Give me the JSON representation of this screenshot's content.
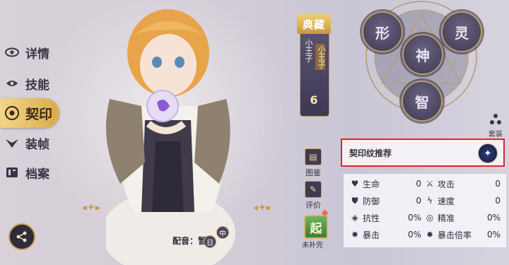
{
  "nav": {
    "items": [
      {
        "label": "详情",
        "icon": "eye-icon"
      },
      {
        "label": "技能",
        "icon": "skill-icon"
      },
      {
        "label": "契印",
        "icon": "seal-icon",
        "active": true
      },
      {
        "label": "装帧",
        "icon": "frame-icon"
      },
      {
        "label": "档案",
        "icon": "archive-icon"
      }
    ]
  },
  "plate": {
    "badge": "典藏",
    "title": "小王子",
    "name": "小王子",
    "level": "6"
  },
  "runes": [
    "形",
    "灵",
    "神",
    "智"
  ],
  "suit": {
    "label": "套装"
  },
  "side": {
    "codex": "图鉴",
    "review": "评价",
    "qi": "起",
    "qi_label": "未补完"
  },
  "recommend": {
    "label": "契印纹推荐"
  },
  "stats": {
    "left": [
      {
        "label": "生命",
        "value": "0",
        "icon": "heart-icon"
      },
      {
        "label": "防御",
        "value": "0",
        "icon": "shield-icon"
      },
      {
        "label": "抗性",
        "value": "0%",
        "icon": "resist-icon"
      },
      {
        "label": "暴击",
        "value": "0%",
        "icon": "crit-icon"
      }
    ],
    "right": [
      {
        "label": "攻击",
        "value": "0",
        "icon": "sword-icon"
      },
      {
        "label": "速度",
        "value": "0",
        "icon": "speed-icon"
      },
      {
        "label": "精准",
        "value": "0%",
        "icon": "target-icon"
      },
      {
        "label": "暴击倍率",
        "value": "0%",
        "icon": "crit-rate-icon"
      }
    ]
  },
  "voice": {
    "label": "配音：暂无",
    "lang1": "日",
    "lang2": "中"
  },
  "colors": {
    "accent": "#d8ab4a",
    "highlight_border": "#e5232b",
    "panel_dark": "#3d3852"
  }
}
